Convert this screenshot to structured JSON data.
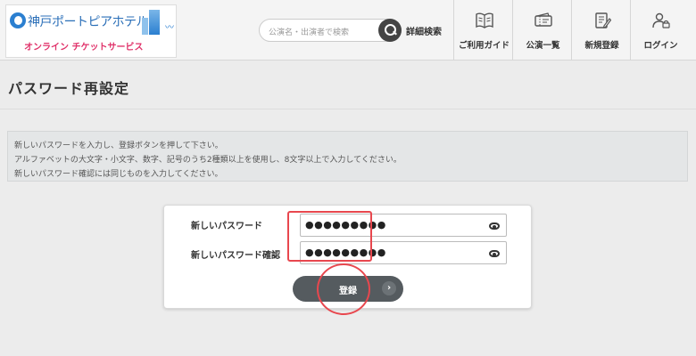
{
  "header": {
    "logo": {
      "name": "神戸ポートピアホテル",
      "subtitle": "オンライン チケットサービス"
    },
    "search": {
      "placeholder": "公演名・出演者で検索"
    },
    "advanced_search": "詳細検索",
    "nav": [
      {
        "label": "ご利用ガイド",
        "icon": "book-icon"
      },
      {
        "label": "公演一覧",
        "icon": "ticket-icon"
      },
      {
        "label": "新規登録",
        "icon": "register-icon"
      },
      {
        "label": "ログイン",
        "icon": "user-lock-icon"
      }
    ]
  },
  "page": {
    "title": "パスワード再設定"
  },
  "notice": {
    "lines": [
      "新しいパスワードを入力し、登録ボタンを押して下さい。",
      "アルファベットの大文字・小文字、数字、記号のうち2種類以上を使用し、8文字以上で入力してください。",
      "新しいパスワード確認には同じものを入力してください。"
    ]
  },
  "form": {
    "new_password": {
      "label": "新しいパスワード",
      "value": "●●●●●●●●●"
    },
    "confirm_password": {
      "label": "新しいパスワード確認",
      "value": "●●●●●●●●●"
    },
    "submit_label": "登録",
    "submit_arrow": "›"
  },
  "colors": {
    "accent_dark": "#555b5f",
    "highlight_annotation": "#e8474e",
    "logo_blue": "#2b6fb8",
    "logo_pink": "#e0326a"
  }
}
